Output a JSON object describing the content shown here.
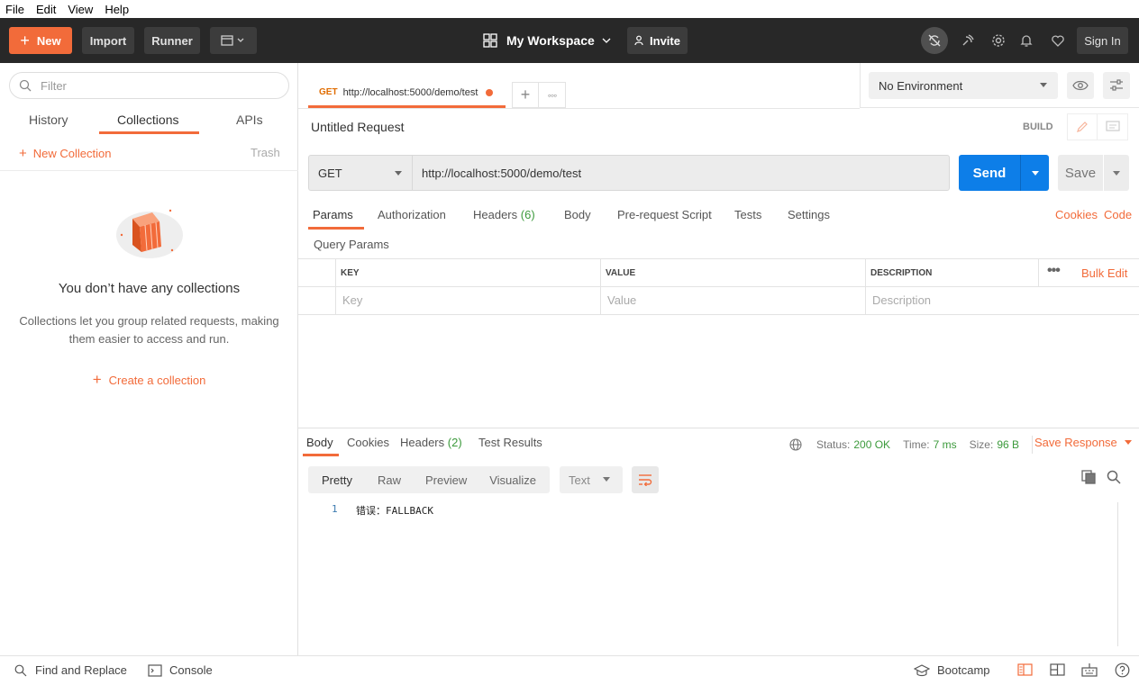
{
  "menu": [
    "File",
    "Edit",
    "View",
    "Help"
  ],
  "header": {
    "new_label": "New",
    "import_label": "Import",
    "runner_label": "Runner",
    "workspace_label": "My Workspace",
    "invite_label": "Invite",
    "signin_label": "Sign In"
  },
  "sidebar": {
    "filter_placeholder": "Filter",
    "tabs": [
      "History",
      "Collections",
      "APIs"
    ],
    "active_tab": "Collections",
    "new_collection_label": "New Collection",
    "trash_label": "Trash",
    "empty_title": "You don’t have any collections",
    "empty_desc": "Collections let you group related requests, making them easier to access and run.",
    "create_collection_label": "Create a collection"
  },
  "request_tab": {
    "method": "GET",
    "url": "http://localhost:5000/demo/test"
  },
  "environment": {
    "selected": "No Environment"
  },
  "request": {
    "title": "Untitled Request",
    "build_label": "BUILD",
    "method": "GET",
    "url": "http://localhost:5000/demo/test",
    "send_label": "Send",
    "save_label": "Save",
    "tabs": {
      "params": "Params",
      "authorization": "Authorization",
      "headers": "Headers",
      "headers_count": "(6)",
      "body": "Body",
      "prerequest": "Pre-request Script",
      "tests": "Tests",
      "settings": "Settings"
    },
    "cookies_link": "Cookies",
    "code_link": "Code",
    "query_params_label": "Query Params",
    "table": {
      "col_key": "KEY",
      "col_value": "VALUE",
      "col_description": "DESCRIPTION",
      "bulk_edit": "Bulk Edit",
      "key_placeholder": "Key",
      "value_placeholder": "Value",
      "description_placeholder": "Description"
    }
  },
  "response": {
    "tabs": {
      "body": "Body",
      "cookies": "Cookies",
      "headers": "Headers",
      "headers_count": "(2)",
      "test_results": "Test Results"
    },
    "status_label": "Status:",
    "status_value": "200 OK",
    "time_label": "Time:",
    "time_value": "7 ms",
    "size_label": "Size:",
    "size_value": "96 B",
    "save_response_label": "Save Response",
    "formats": [
      "Pretty",
      "Raw",
      "Preview",
      "Visualize"
    ],
    "text_format": "Text",
    "line_number": "1",
    "body_text": "错误：FALLBACK"
  },
  "statusbar": {
    "find_replace": "Find and Replace",
    "console": "Console",
    "bootcamp": "Bootcamp"
  },
  "colors": {
    "accent": "#f26b3a",
    "send_blue": "#0d7ee8",
    "header_bg": "#282828",
    "status_green": "#3c9a3c"
  }
}
